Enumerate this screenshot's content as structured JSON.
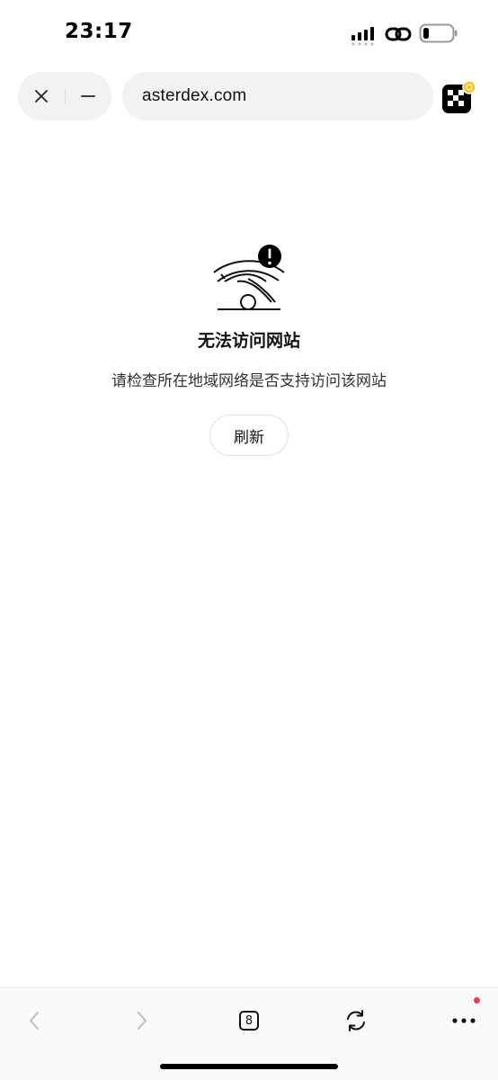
{
  "status_bar": {
    "time": "23:17"
  },
  "browser": {
    "url": "asterdex.com"
  },
  "error_page": {
    "title": "无法访问网站",
    "description": "请检查所在地域网络是否支持访问该网站",
    "refresh_label": "刷新"
  },
  "toolbar": {
    "tab_count": "8"
  },
  "icons": {
    "close": "close-icon",
    "minimize": "minimize-icon",
    "extension": "okx-extension-icon",
    "back": "back-icon",
    "forward": "forward-icon",
    "tabs": "tabs-icon",
    "reload": "reload-icon",
    "more": "more-icon"
  },
  "colors": {
    "pill_background": "#f2f2f4",
    "notification_dot": "#ef3b55",
    "badge": "#f5c518"
  }
}
